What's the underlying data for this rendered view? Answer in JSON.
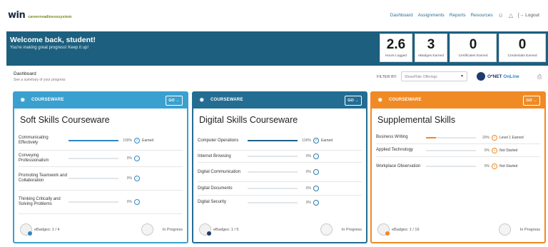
{
  "nav": {
    "logo_main": "win",
    "logo_tag": "careerreadinesssystem",
    "links": [
      "Dashboard",
      "Assignments",
      "Reports",
      "Resources"
    ],
    "logout": "Logout"
  },
  "banner": {
    "title": "Welcome back, student!",
    "subtitle": "You're making great progress! Keep it up!",
    "stats": [
      {
        "value": "2.6",
        "label": "Hours Logged"
      },
      {
        "value": "3",
        "label": "eBadges Earned"
      },
      {
        "value": "0",
        "label": "Certificates Earned"
      },
      {
        "value": "0",
        "label": "Credentials Earned"
      }
    ]
  },
  "dashboard": {
    "title": "Dashboard",
    "subtitle": "See a summary of your progress",
    "filter_label": "FILTER BY:",
    "filter_placeholder": "Show/Hide Offerings",
    "onet_brand": "O*NET",
    "onet_suffix": "OnLine"
  },
  "cards": [
    {
      "type": "COURSEWARE",
      "go": "GO",
      "title": "Soft Skills Courseware",
      "rows": [
        {
          "name": "Communicating Effectively",
          "percent": 100,
          "percent_label": "100%",
          "status": "Earned"
        },
        {
          "name": "Conveying Professionalism",
          "percent": 0,
          "percent_label": "0%",
          "status": ""
        },
        {
          "name": "Promoting Teamwork and Collaboration",
          "percent": 0,
          "percent_label": "0%",
          "status": ""
        },
        {
          "name": "Thinking Critically and Solving Problems",
          "percent": 0,
          "percent_label": "0%",
          "status": ""
        }
      ],
      "ebadges": "eBadges: 1 / 4",
      "progress_status": "In Progress"
    },
    {
      "type": "COURSEWARE",
      "go": "GO",
      "title": "Digital Skills Courseware",
      "rows": [
        {
          "name": "Computer Operations",
          "percent": 100,
          "percent_label": "100%",
          "status": "Earned"
        },
        {
          "name": "Internet Browsing",
          "percent": 0,
          "percent_label": "0%",
          "status": ""
        },
        {
          "name": "Digital Communication",
          "percent": 0,
          "percent_label": "0%",
          "status": ""
        },
        {
          "name": "Digital Documents",
          "percent": 0,
          "percent_label": "0%",
          "status": ""
        },
        {
          "name": "Digital Security",
          "percent": 0,
          "percent_label": "0%",
          "status": ""
        }
      ],
      "ebadges": "eBadges: 1 / 5",
      "progress_status": "In Progress"
    },
    {
      "type": "COURSEWARE",
      "go": "GO",
      "title": "Supplemental Skills",
      "rows": [
        {
          "name": "Business Writing",
          "percent": 20,
          "percent_label": "20%",
          "status": "Level 1 Earned"
        },
        {
          "name": "Applied Technology",
          "percent": 0,
          "percent_label": "0%",
          "status": "Not Started"
        },
        {
          "name": "Workplace Observation",
          "percent": 0,
          "percent_label": "0%",
          "status": "Not Started"
        }
      ],
      "ebadges": "eBadges: 1 / 16",
      "progress_status": "In Progress"
    }
  ]
}
